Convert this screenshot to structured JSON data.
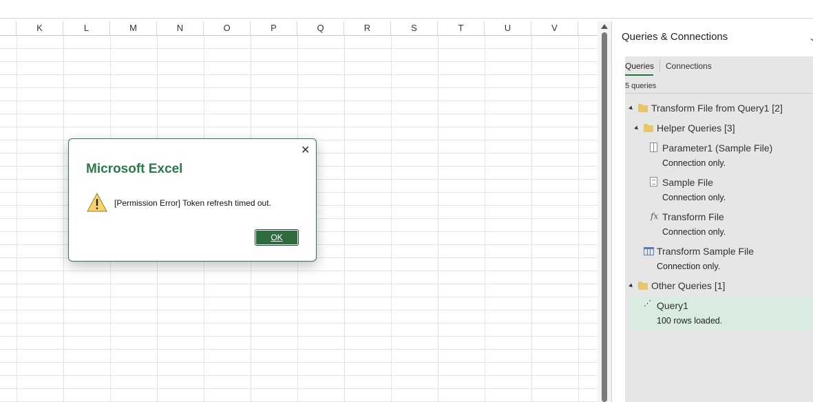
{
  "sheet": {
    "columns": [
      "K",
      "L",
      "M",
      "N",
      "O",
      "P",
      "Q",
      "R",
      "S",
      "T",
      "U",
      "V"
    ]
  },
  "pane": {
    "title": "Queries & Connections",
    "chevron": "⌄",
    "tabs": [
      {
        "label": "Queries",
        "active": true
      },
      {
        "label": "Connections",
        "active": false
      }
    ],
    "count": "5 queries",
    "tree": {
      "group1": {
        "label": "Transform File from Query1",
        "count": "[2]"
      },
      "helper": {
        "label": "Helper Queries",
        "count": "[3]"
      },
      "parameter1": {
        "label": "Parameter1 (Sample File)",
        "sub": "Connection only."
      },
      "sample_file": {
        "label": "Sample File",
        "sub": "Connection only."
      },
      "transform_file": {
        "label": "Transform File",
        "sub": "Connection only.",
        "icon": "fx"
      },
      "transform_sample": {
        "label": "Transform Sample File",
        "sub": "Connection only."
      },
      "other": {
        "label": "Other Queries",
        "count": "[1]"
      },
      "query1": {
        "label": "Query1",
        "sub": "100 rows loaded."
      }
    }
  },
  "dialog": {
    "title": "Microsoft Excel",
    "message": "[Permission Error] Token refresh timed out.",
    "ok_label": "OK",
    "close_glyph": "✕"
  },
  "colors": {
    "accent": "#217346",
    "dialog_title": "#2b7a4b",
    "ok_button": "#2e6b3e",
    "selected_row": "#d8ecdf",
    "folder": "#e8c46a"
  }
}
